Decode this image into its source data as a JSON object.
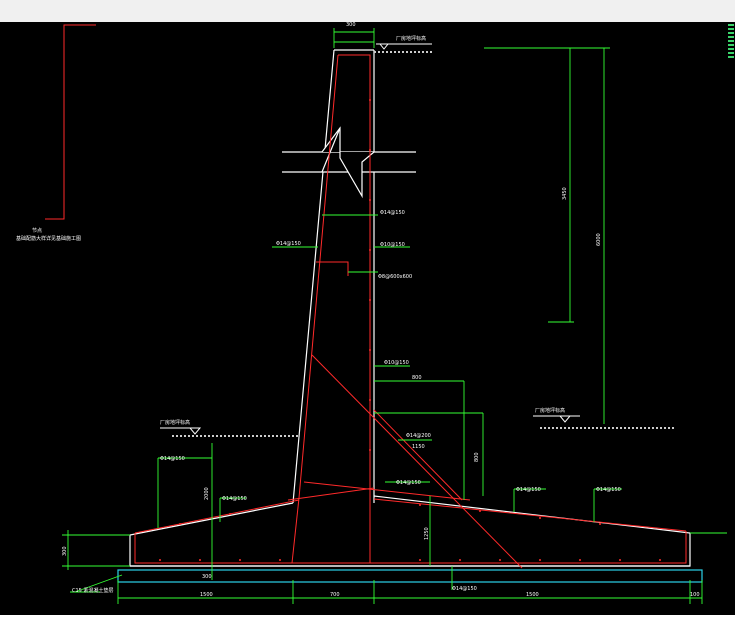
{
  "colors": {
    "background": "#000000",
    "concrete_outline": "#ffffff",
    "rebar": "#ff2a2a",
    "dimension": "#33ff33",
    "cushion": "#2bd3e8",
    "text": "#ffffff"
  },
  "labels": {
    "top_width_dim": "300",
    "top_level": "厂房地坪标高",
    "left_note_1": "节点",
    "left_note_2": "基础配筋大样详见基础施工图",
    "height_main": "6000",
    "height_upper": "3450",
    "rebar_left_outer": "Φ14@150",
    "rebar_right_1": "Φ14@150",
    "rebar_right_2": "Φ10@150",
    "rebar_stirrup": "Φ8@600x600",
    "rebar_mid": "Φ10@150",
    "dim_800": "800",
    "rebar_haunch": "Φ14@200",
    "dim_1150": "1150",
    "dim_800_v": "800",
    "right_ground": "厂房地坪标高",
    "left_ground": "厂房地坪标高",
    "rebar_left_base_1": "Φ14@150",
    "dim_2000": "2000",
    "rebar_left_base_2": "Φ14@150",
    "rebar_center_base": "Φ14@150",
    "rebar_base_r1": "Φ14@150",
    "rebar_base_r2": "Φ14@150",
    "dim_1250": "1250",
    "dim_300_left": "300",
    "dim_300_bot": "300",
    "rebar_bottom": "Φ14@150",
    "cushion_note": "C15 素混凝土垫层",
    "dim_bottom_1": "1500",
    "dim_bottom_2": "700",
    "dim_bottom_3": "1500",
    "dim_bottom_4": "100"
  }
}
